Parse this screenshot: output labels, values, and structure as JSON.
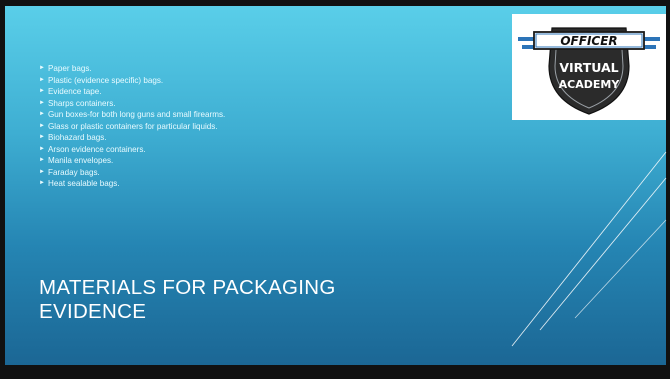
{
  "slide": {
    "bullets": [
      "Paper bags.",
      "Plastic (evidence specific) bags.",
      "Evidence tape.",
      "Sharps containers.",
      "Gun boxes-for both long guns and small firearms.",
      "Glass or plastic containers for particular liquids.",
      "Biohazard bags.",
      "Arson evidence containers.",
      "Manila envelopes.",
      "Faraday bags.",
      "Heat sealable bags."
    ],
    "title_line1": "MATERIALS FOR PACKAGING",
    "title_line2": "EVIDENCE"
  },
  "logo": {
    "word1": "OFFICER",
    "word2": "VIRTUAL",
    "word3": "ACADEMY"
  },
  "colors": {
    "accent_blue": "#2c74b8",
    "bullet_text": "#e9fbff"
  }
}
